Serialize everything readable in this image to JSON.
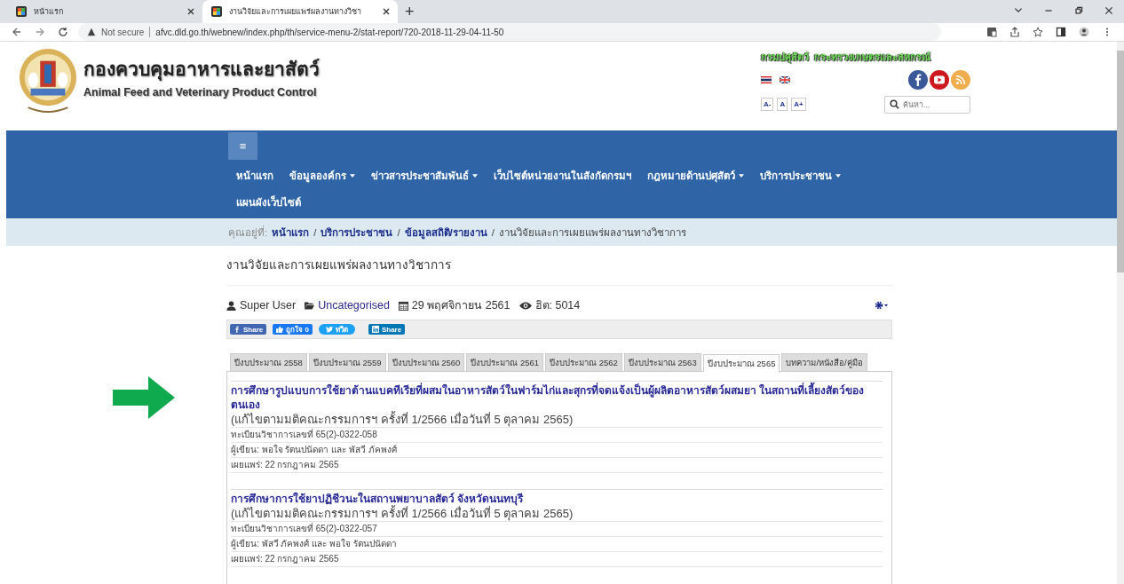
{
  "browser": {
    "tabs": [
      {
        "title": "หน้าแรก",
        "selected": false
      },
      {
        "title": "งานวิจัยและการเผยแพร่ผลงานทางวิชา",
        "selected": true
      }
    ],
    "new_tab": "+",
    "address": {
      "security": "Not secure",
      "url": "afvc.dld.go.th/webnew/index.php/th/service-menu-2/stat-report/720-2018-11-29-04-11-50"
    }
  },
  "header": {
    "title_th": "กองควบคุมอาหารและยาสัตว์",
    "title_en": "Animal Feed and Veterinary Product Control",
    "ministry": "กรมปศุสัตว์  กระทรวงเกษตรและสหกรณ์",
    "font_buttons": [
      "A-",
      "A",
      "A+"
    ],
    "search": {
      "placeholder": "ค้นหา..."
    }
  },
  "nav": {
    "menu_button": "≡",
    "items": [
      {
        "label": "หน้าแรก",
        "dropdown": false
      },
      {
        "label": "ข้อมูลองค์กร",
        "dropdown": true
      },
      {
        "label": "ข่าวสารประชาสัมพันธ์",
        "dropdown": true
      },
      {
        "label": "เว็บไซต์หน่วยงานในสังกัดกรมฯ",
        "dropdown": false
      },
      {
        "label": "กฎหมายด้านปศุสัตว์",
        "dropdown": true
      },
      {
        "label": "บริการประชาชน",
        "dropdown": true
      },
      {
        "label": "แผนผังเว็บไซต์",
        "dropdown": false
      }
    ]
  },
  "breadcrumb": {
    "label": "คุณอยู่ที่:",
    "separator": "/",
    "items": [
      {
        "label": "หน้าแรก",
        "link": true
      },
      {
        "label": "บริการประชาชน",
        "link": true
      },
      {
        "label": "ข้อมูลสถิติ/รายงาน",
        "link": true
      },
      {
        "label": "งานวิจัยและการเผยแพร่ผลงานทางวิชาการ",
        "link": false
      }
    ]
  },
  "article": {
    "title": "งานวิจัยและการเผยแพร่ผลงานทางวิชาการ",
    "meta": {
      "author": "Super User",
      "category": "Uncategorised",
      "date": "29 พฤศจิกายน 2561",
      "hits": "ฮิต: 5014"
    },
    "share_buttons": [
      {
        "kind": "facebook",
        "label": "Share"
      },
      {
        "kind": "like",
        "label": "ถูกใจ 0"
      },
      {
        "kind": "twitter",
        "label": "ทวีต"
      },
      {
        "kind": "linkedin",
        "label": "Share"
      }
    ],
    "tabs": [
      {
        "label": "ปีงบประมาณ 2558",
        "selected": false
      },
      {
        "label": "ปีงบประมาณ 2559",
        "selected": false
      },
      {
        "label": "ปีงบประมาณ 2560",
        "selected": false
      },
      {
        "label": "ปีงบประมาณ 2561",
        "selected": false
      },
      {
        "label": "ปีงบประมาณ 2562",
        "selected": false
      },
      {
        "label": "ปีงบประมาณ 2563",
        "selected": false
      },
      {
        "label": "ปีงบประมาณ 2565",
        "selected": true
      },
      {
        "label": "บทความ/หนังสือ/คู่มือ",
        "selected": false
      }
    ],
    "items": [
      {
        "title": "การศึกษารูปแบบการใช้ยาต้านแบคทีเรียที่ผสมในอาหารสัตว์ในฟาร์มไก่และสุกรที่จดแจ้งเป็นผู้ผลิตอาหารสัตว์ผสมยา ในสถานที่เลี้ยงสัตว์ของตนเอง",
        "note": "(แก้ไขตามมติคณะกรรมการฯ ครั้งที่ 1/2566 เมื่อวันที่ 5 ตุลาคม 2565)",
        "lines": [
          "ทะเบียนวิชาการเลขที่ 65(2)-0322-058",
          "ผู้เขียน: พอใจ รัตนปนัดดา และ พัสวี ภัคพงศ์",
          "เผยแพร่: 22 กรกฎาคม 2565"
        ]
      },
      {
        "title": "การศึกษาการใช้ยาปฏิชีวนะในสถานพยาบาลสัตว์ จังหวัดนนทบุรี",
        "note": "(แก้ไขตามมติคณะกรรมการฯ ครั้งที่ 1/2566 เมื่อวันที่ 5 ตุลาคม 2565)",
        "lines": [
          "ทะเบียนวิชาการเลขที่ 65(2)-0322-057",
          "ผู้เขียน: พัสวี ภัคพงศ์ และ พอใจ รัตนปนัดดา",
          "เผยแพร่: 22 กรกฎาคม 2565"
        ]
      }
    ]
  }
}
